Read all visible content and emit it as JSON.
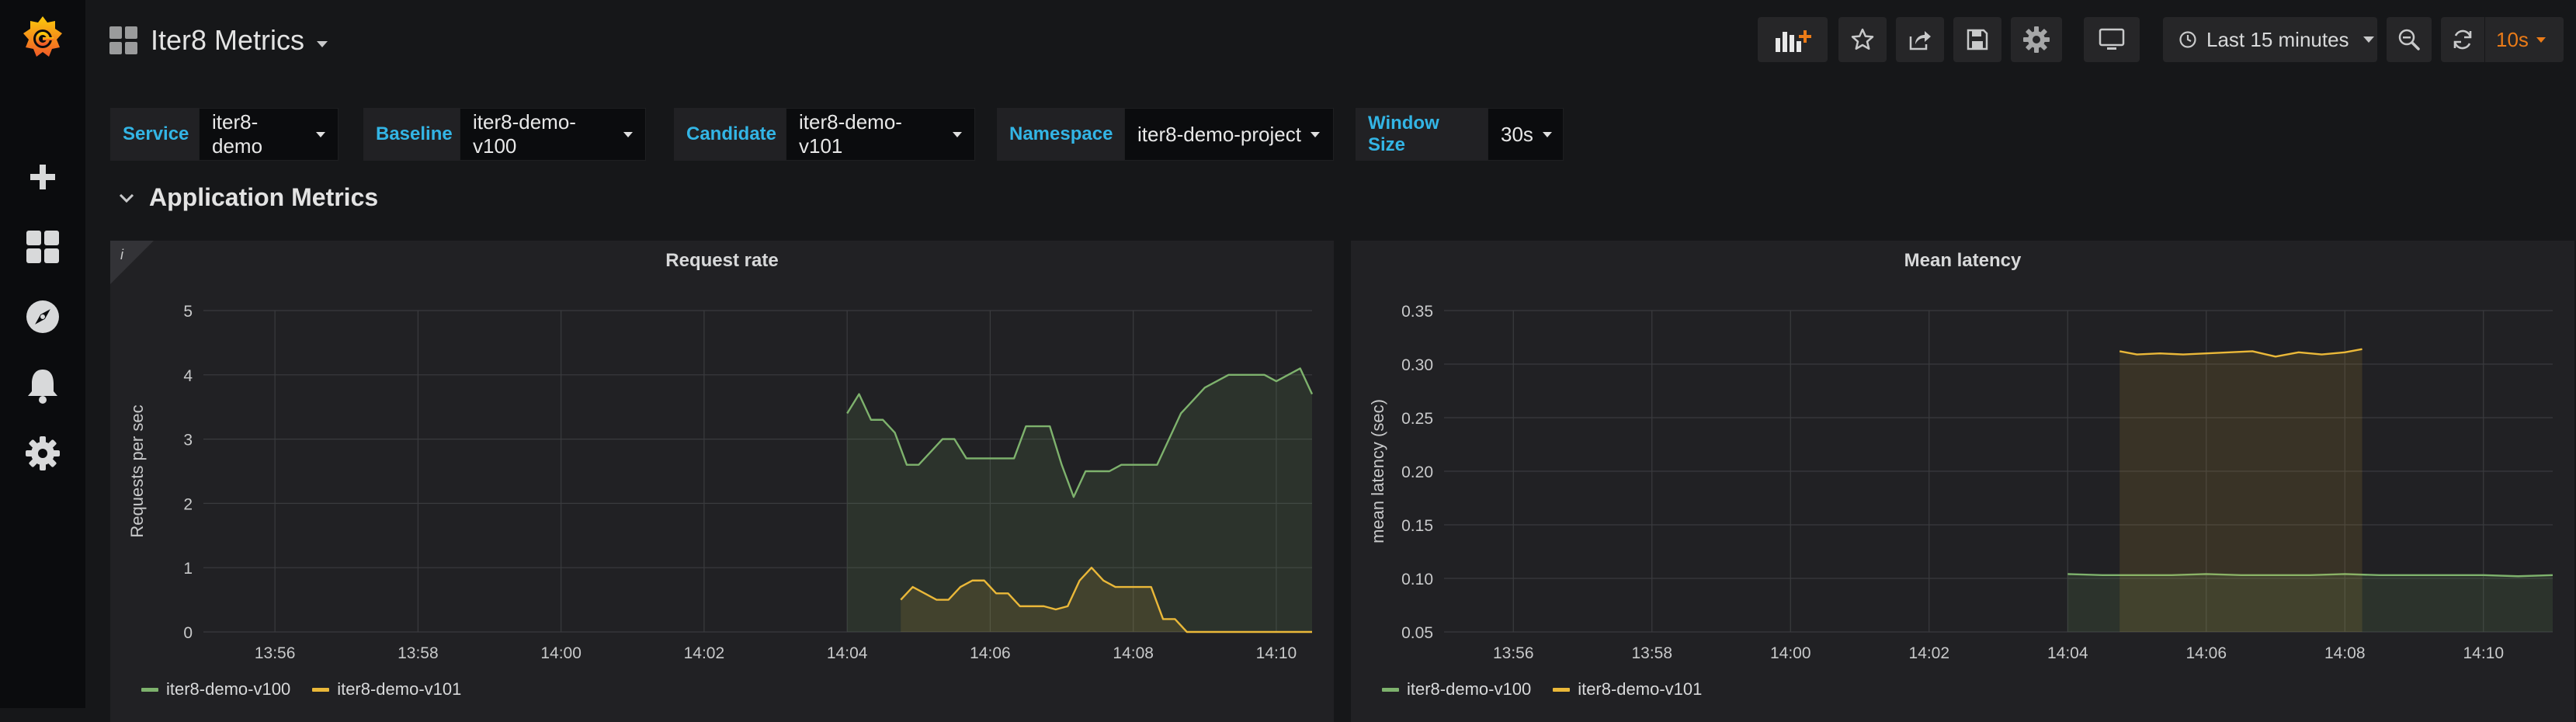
{
  "app": {
    "dashboard_title": "Iter8 Metrics"
  },
  "toolbar": {
    "time_range_label": "Last 15 minutes",
    "refresh_interval": "10s",
    "icons": [
      "add-panel-icon",
      "star-icon",
      "share-icon",
      "save-icon",
      "settings-icon",
      "tv-mode-icon",
      "clock-icon",
      "zoom-out-icon",
      "refresh-icon"
    ]
  },
  "sidebar": {
    "icons": [
      "grafana-logo",
      "plus-icon",
      "dashboards-icon",
      "explore-icon",
      "bell-icon",
      "gear-icon"
    ]
  },
  "variables": [
    {
      "label": "Service",
      "value": "iter8-demo"
    },
    {
      "label": "Baseline",
      "value": "iter8-demo-v100"
    },
    {
      "label": "Candidate",
      "value": "iter8-demo-v101"
    },
    {
      "label": "Namespace",
      "value": "iter8-demo-project"
    },
    {
      "label": "Window Size",
      "value": "30s"
    }
  ],
  "row": {
    "title": "Application Metrics"
  },
  "colors": {
    "baseline": "#7eb26d",
    "candidate": "#eab839",
    "accent_label": "#33b5e5",
    "refresh_orange": "#eb7b18"
  },
  "panels": [
    {
      "title": "Request rate",
      "info_glyph": "i",
      "chart_data": {
        "type": "line",
        "title": "Request rate",
        "xlabel": "",
        "ylabel": "Requests per sec",
        "x_ticks": [
          "13:56",
          "13:58",
          "14:00",
          "14:02",
          "14:04",
          "14:06",
          "14:08",
          "14:10"
        ],
        "y_ticks": [
          "0",
          "1",
          "2",
          "3",
          "4",
          "5"
        ],
        "xlim": [
          "13:55",
          "14:10:30"
        ],
        "ylim": [
          0,
          5
        ],
        "grid": true,
        "legend_position": "bottom-left",
        "series": [
          {
            "name": "iter8-demo-v100",
            "color": "#7eb26d",
            "fill": true,
            "x": [
              "14:04:00",
              "14:04:10",
              "14:04:20",
              "14:04:30",
              "14:04:40",
              "14:04:50",
              "14:05:00",
              "14:05:10",
              "14:05:20",
              "14:05:30",
              "14:05:40",
              "14:05:50",
              "14:06:00",
              "14:06:10",
              "14:06:20",
              "14:06:30",
              "14:06:40",
              "14:06:50",
              "14:07:00",
              "14:07:10",
              "14:07:20",
              "14:07:30",
              "14:07:40",
              "14:07:50",
              "14:08:00",
              "14:08:10",
              "14:08:20",
              "14:08:30",
              "14:08:40",
              "14:08:50",
              "14:09:00",
              "14:09:10",
              "14:09:20",
              "14:09:30",
              "14:09:40",
              "14:09:50",
              "14:10:00",
              "14:10:10",
              "14:10:20",
              "14:10:30"
            ],
            "values": [
              3.4,
              3.7,
              3.3,
              3.3,
              3.1,
              2.6,
              2.6,
              2.8,
              3.0,
              3.0,
              2.7,
              2.7,
              2.7,
              2.7,
              2.7,
              3.2,
              3.2,
              3.2,
              2.6,
              2.1,
              2.5,
              2.5,
              2.5,
              2.6,
              2.6,
              2.6,
              2.6,
              3.0,
              3.4,
              3.6,
              3.8,
              3.9,
              4.0,
              4.0,
              4.0,
              4.0,
              3.9,
              4.0,
              4.1,
              3.7
            ]
          },
          {
            "name": "iter8-demo-v101",
            "color": "#eab839",
            "fill": true,
            "x": [
              "14:04:45",
              "14:04:55",
              "14:05:05",
              "14:05:15",
              "14:05:25",
              "14:05:35",
              "14:05:45",
              "14:05:55",
              "14:06:05",
              "14:06:15",
              "14:06:25",
              "14:06:35",
              "14:06:45",
              "14:06:55",
              "14:07:05",
              "14:07:15",
              "14:07:25",
              "14:07:35",
              "14:07:45",
              "14:07:55",
              "14:08:05",
              "14:08:15",
              "14:08:25",
              "14:08:35",
              "14:08:45",
              "14:09:00",
              "14:09:30",
              "14:10:00",
              "14:10:30"
            ],
            "values": [
              0.5,
              0.7,
              0.6,
              0.5,
              0.5,
              0.7,
              0.8,
              0.8,
              0.6,
              0.6,
              0.4,
              0.4,
              0.4,
              0.35,
              0.4,
              0.8,
              1.0,
              0.8,
              0.7,
              0.7,
              0.7,
              0.7,
              0.2,
              0.2,
              0,
              0,
              0,
              0,
              0
            ]
          }
        ]
      }
    },
    {
      "title": "Mean latency",
      "chart_data": {
        "type": "line",
        "title": "Mean latency",
        "xlabel": "",
        "ylabel": "mean latency (sec)",
        "x_ticks": [
          "13:56",
          "13:58",
          "14:00",
          "14:02",
          "14:04",
          "14:06",
          "14:08",
          "14:10"
        ],
        "y_ticks": [
          "0.05",
          "0.10",
          "0.15",
          "0.20",
          "0.25",
          "0.30",
          "0.35"
        ],
        "xlim": [
          "13:55",
          "14:11"
        ],
        "ylim": [
          0.05,
          0.35
        ],
        "grid": true,
        "legend_position": "bottom-left",
        "series": [
          {
            "name": "iter8-demo-v100",
            "color": "#7eb26d",
            "fill": true,
            "x": [
              "14:04:00",
              "14:04:30",
              "14:05:00",
              "14:05:30",
              "14:06:00",
              "14:06:30",
              "14:07:00",
              "14:07:30",
              "14:08:00",
              "14:08:30",
              "14:09:00",
              "14:09:30",
              "14:10:00",
              "14:10:30",
              "14:11:00"
            ],
            "values": [
              0.104,
              0.103,
              0.103,
              0.103,
              0.104,
              0.103,
              0.103,
              0.103,
              0.104,
              0.103,
              0.103,
              0.103,
              0.103,
              0.102,
              0.103
            ]
          },
          {
            "name": "iter8-demo-v101",
            "color": "#eab839",
            "fill": true,
            "x": [
              "14:04:45",
              "14:05:00",
              "14:05:20",
              "14:05:40",
              "14:06:00",
              "14:06:20",
              "14:06:40",
              "14:07:00",
              "14:07:20",
              "14:07:40",
              "14:08:00",
              "14:08:15"
            ],
            "values": [
              0.312,
              0.309,
              0.31,
              0.309,
              0.31,
              0.311,
              0.312,
              0.307,
              0.311,
              0.309,
              0.311,
              0.314
            ]
          }
        ]
      }
    }
  ]
}
